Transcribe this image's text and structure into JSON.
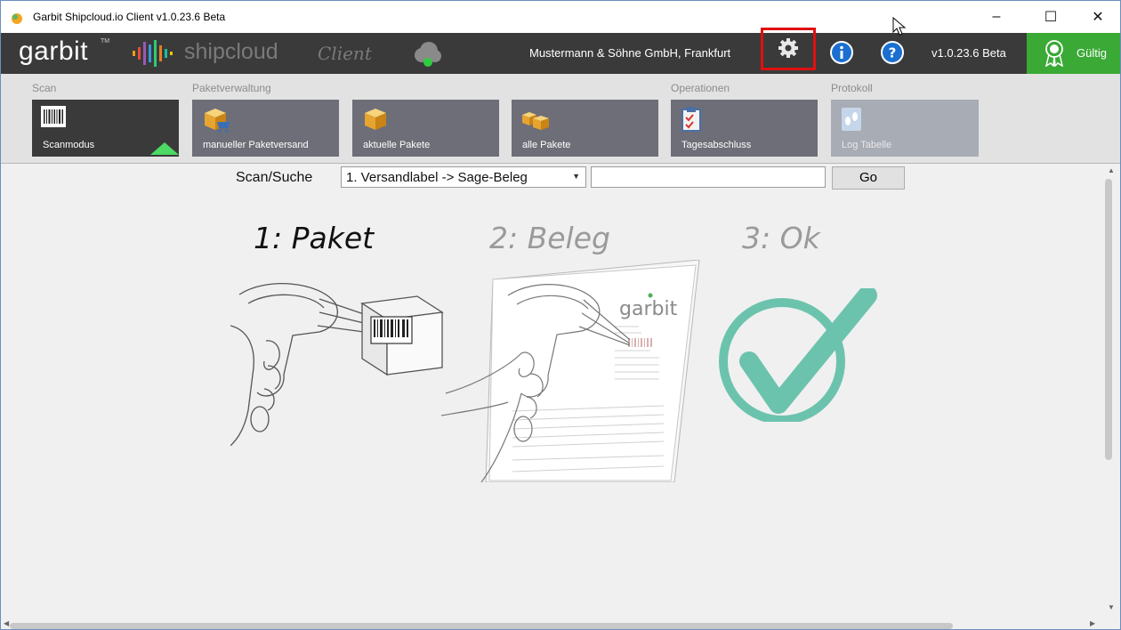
{
  "window": {
    "title": "Garbit Shipcloud.io Client v1.0.23.6 Beta",
    "controls": {
      "minimize": "–",
      "maximize": "☐",
      "close": "✕"
    }
  },
  "topbar": {
    "logo_text": "garbit",
    "logo_tm": "TM",
    "product": "shipcloud",
    "product_suffix": "Client",
    "company": "Mustermann & Söhne GmbH, Frankfurt",
    "version": "v1.0.23.6 Beta",
    "license_status": "Gültig",
    "accent_color": "#3aa935",
    "highlight_color": "#e01010"
  },
  "ribbon": {
    "groups": [
      {
        "label": "Scan"
      },
      {
        "label": "Paketverwaltung"
      },
      {
        "label": "Operationen"
      },
      {
        "label": "Protokoll"
      }
    ],
    "tiles": [
      {
        "label": "Scanmodus",
        "icon": "barcode-icon",
        "state": "active"
      },
      {
        "label": "manueller Paketversand",
        "icon": "package-cart-icon",
        "state": "normal"
      },
      {
        "label": "aktuelle Pakete",
        "icon": "package-icon",
        "state": "normal"
      },
      {
        "label": "alle Pakete",
        "icon": "packages-icon",
        "state": "normal"
      },
      {
        "label": "Tagesabschluss",
        "icon": "clipboard-icon",
        "state": "normal"
      },
      {
        "label": "Log Tabelle",
        "icon": "footprint-icon",
        "state": "disabled"
      }
    ]
  },
  "scan": {
    "label": "Scan/Suche",
    "mode_selected": "1. Versandlabel -> Sage-Beleg",
    "input_value": "",
    "go_label": "Go"
  },
  "steps": {
    "step1": "1: Paket",
    "step2": "2: Beleg",
    "step3": "3: Ok",
    "doc_logo": "garbit",
    "check_color": "#6cc3ad"
  }
}
